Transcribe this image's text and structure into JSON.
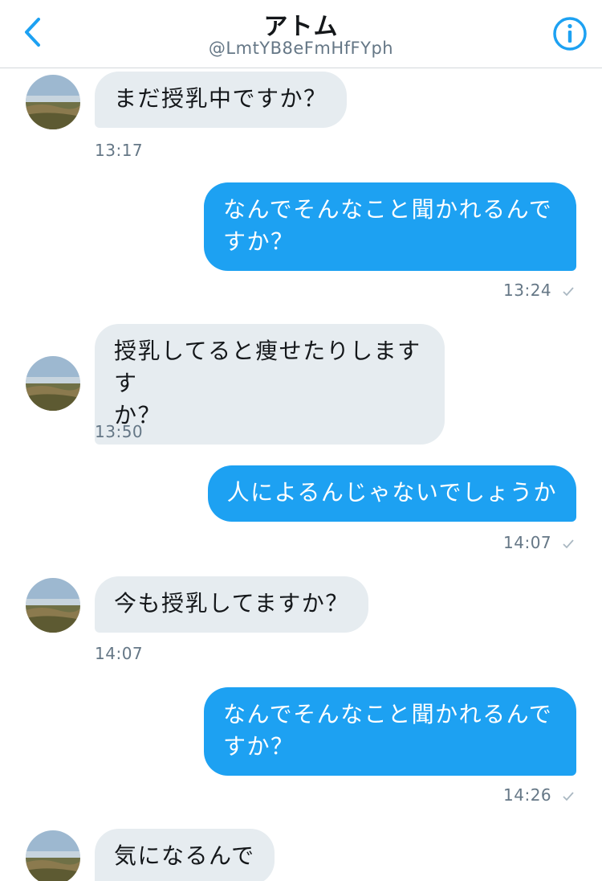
{
  "header": {
    "title": "アトム",
    "handle": "@LmtYB8eFmHfFYph"
  },
  "messages": [
    {
      "direction": "in",
      "text": "まだ授乳中ですか？",
      "time": "13:17"
    },
    {
      "direction": "out",
      "text": "なんでそんなこと聞かれるんで\nすか？",
      "time": "13:24"
    },
    {
      "direction": "in",
      "text": "授乳してると痩せたりしますす\nか？",
      "time": "13:50"
    },
    {
      "direction": "out",
      "text": "人によるんじゃないでしょうか",
      "time": "14:07"
    },
    {
      "direction": "in",
      "text": "今も授乳してますか？",
      "time": "14:07"
    },
    {
      "direction": "out",
      "text": "なんでそんなこと聞かれるんで\nすか？",
      "time": "14:26"
    },
    {
      "direction": "in",
      "text": "気になるんで",
      "time": ""
    }
  ],
  "colors": {
    "accent": "#1da1f2",
    "incoming_bubble": "#e6ecf0",
    "text_dark": "#14171a",
    "text_muted": "#657786"
  },
  "icons": {
    "back": "chevron-left-icon",
    "info": "info-circle-icon",
    "read": "checkmark-icon"
  }
}
